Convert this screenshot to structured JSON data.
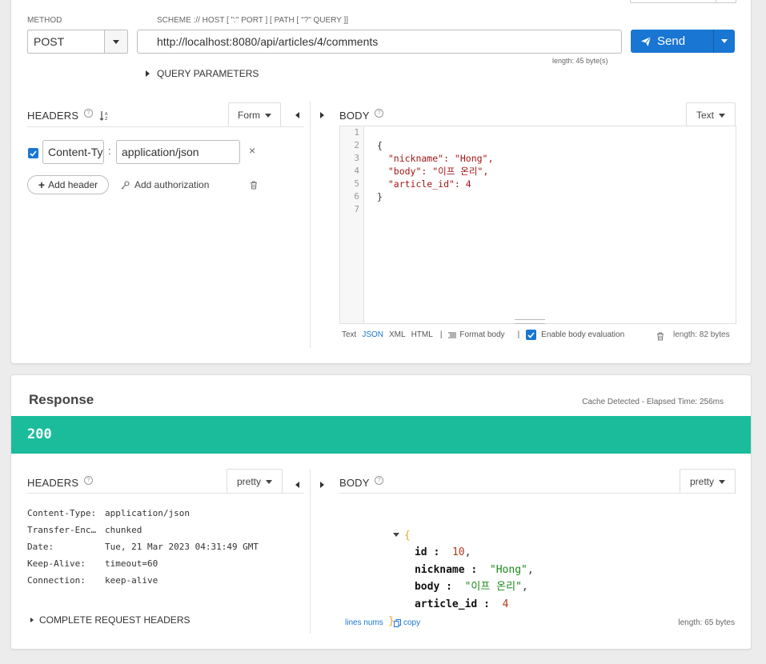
{
  "request": {
    "method_label": "METHOD",
    "method_value": "POST",
    "url_label": "SCHEME :// HOST [ \":\" PORT ] [ PATH [ \"?\" QUERY ]]",
    "url_value": "http://localhost:8080/api/articles/4/comments",
    "url_length": "length: 45 byte(s)",
    "send_label": "Send",
    "query_parameters_label": "QUERY PARAMETERS"
  },
  "req_headers": {
    "title": "HEADERS",
    "mode": "Form",
    "rows": [
      {
        "enabled": true,
        "name": "Content-Type",
        "value": "application/json"
      }
    ],
    "add_header": "Add header",
    "add_authorization": "Add authorization"
  },
  "req_body": {
    "title": "BODY",
    "mode": "Text",
    "line_numbers": [
      "1",
      "2",
      "3",
      "4",
      "5",
      "6",
      "7"
    ],
    "lines": [
      "",
      "{",
      "  \"nickname\": \"Hong\",",
      "  \"body\": \"이프 온리\",",
      "  \"article_id\": 4",
      "}",
      ""
    ],
    "formats": [
      "Text",
      "JSON",
      "XML",
      "HTML"
    ],
    "active_format": "JSON",
    "separator": "|",
    "format_body": "Format body",
    "enable_body_evaluation": "Enable body evaluation",
    "length": "length: 82 bytes"
  },
  "response": {
    "title": "Response",
    "meta": "Cache Detected - Elapsed Time: 256ms",
    "status": "200",
    "status_color": "#1abc9c",
    "headers_title": "HEADERS",
    "headers_mode": "pretty",
    "headers": [
      {
        "key": "Content-Type:",
        "value": "application/json"
      },
      {
        "key": "Transfer-Encoding:",
        "value": "chunked"
      },
      {
        "key": "Date:",
        "value": "Tue, 21 Mar 2023 04:31:49 GMT"
      },
      {
        "key": "Keep-Alive:",
        "value": "timeout=60"
      },
      {
        "key": "Connection:",
        "value": "keep-alive"
      }
    ],
    "complete_request_headers": "COMPLETE REQUEST HEADERS",
    "body_title": "BODY",
    "body_mode": "pretty",
    "body": {
      "open": "{",
      "close": "}",
      "fields": [
        {
          "key": "id",
          "value": "10",
          "type": "number"
        },
        {
          "key": "nickname",
          "value": "\"Hong\"",
          "type": "string"
        },
        {
          "key": "body",
          "value": "\"이프 온리\"",
          "type": "string"
        },
        {
          "key": "article_id",
          "value": "4",
          "type": "number"
        }
      ]
    },
    "lines_nums": "lines nums",
    "copy": "copy",
    "length": "length: 65 bytes"
  },
  "colors": {
    "accent": "#1976d2",
    "status_ok": "#1abc9c"
  }
}
